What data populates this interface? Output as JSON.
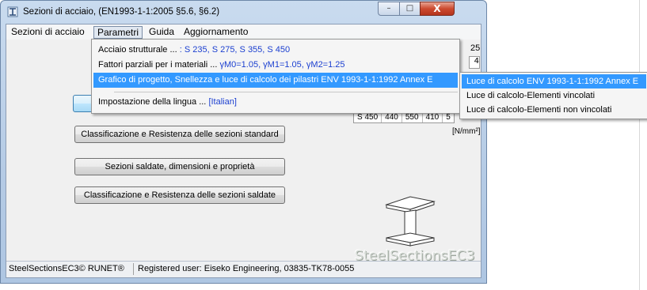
{
  "window": {
    "title": "Sezioni di acciaio, (EN1993-1-1:2005 §5.6, §6.2)",
    "controls": {
      "minimize": "–",
      "maximize": "□",
      "close": "X"
    }
  },
  "menubar": {
    "items": [
      "Sezioni di acciaio",
      "Parametri",
      "Guida",
      "Aggiornamento"
    ]
  },
  "dropdown": {
    "acciaio_label": "Acciaio strutturale ...",
    "acciaio_value": ": S 235, S 275, S 355, S 450",
    "fattori_label": "Fattori parziali per i materiali ...",
    "fattori_value": "γM0=1.05, γM1=1.05, γM2=1.25",
    "grafico_label": "Grafico di progetto, Snellezza e luce di calcolo dei pilastri ENV 1993-1-1:1992 Annex E",
    "lingua_label": "Impostazione della lingua ...",
    "lingua_value": "[Italian]"
  },
  "submenu": {
    "items": [
      "Luce di calcolo ENV 1993-1-1:1992 Annex E",
      "Luce di calcolo-Elementi vincolati",
      "Luce di calcolo-Elementi non vincolati"
    ]
  },
  "main": {
    "top_number": "25",
    "box_fragment": "4",
    "table_cells": [
      "S 450",
      "440",
      "550",
      "410",
      "5"
    ],
    "unit": "[N/mm²]",
    "buttons": {
      "classificazione_standard": "Classificazione e Resistenza delle sezioni standard",
      "saldate_dimensioni": "Sezioni saldate, dimensioni e proprietà",
      "classificazione_saldate": "Classificazione e Resistenza delle sezioni saldate"
    },
    "watermark": "SteelSectionsEC3"
  },
  "statusbar": {
    "product": "SteelSectionsEC3© RUNET®",
    "registration": "Registered user: Eiseko Engineering, 03835-TK78-0055"
  },
  "colors": {
    "highlight": "#3399ff",
    "value_blue": "#1b3fd0"
  }
}
